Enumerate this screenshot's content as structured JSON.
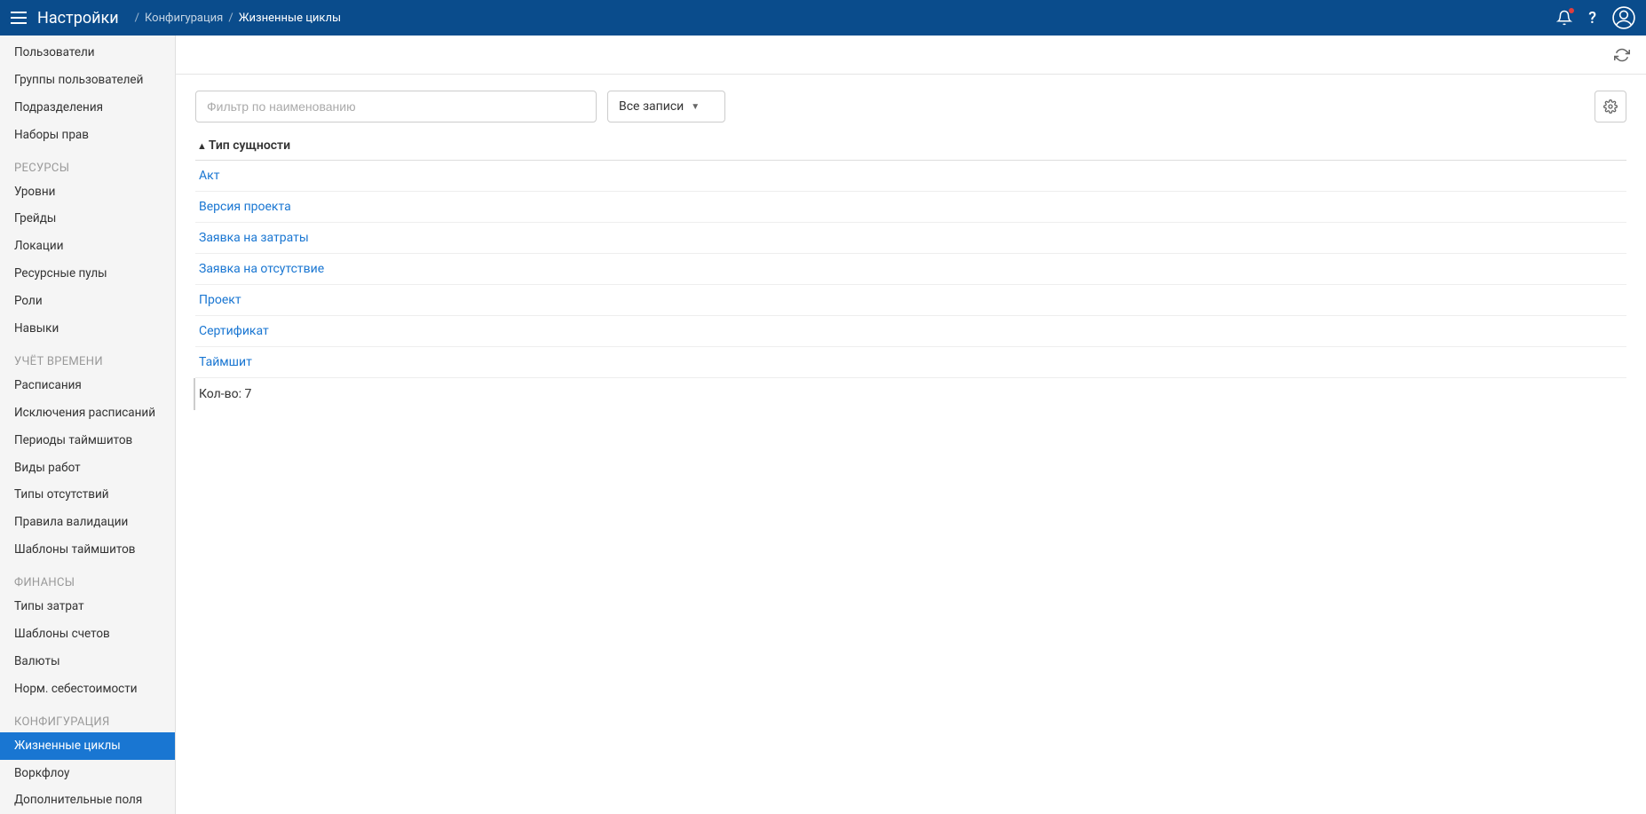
{
  "header": {
    "title": "Настройки",
    "breadcrumb": [
      "Конфигурация",
      "Жизненные циклы"
    ]
  },
  "sidebar": {
    "top_items": [
      "Пользователи",
      "Группы пользователей",
      "Подразделения",
      "Наборы прав"
    ],
    "groups": [
      {
        "title": "РЕСУРСЫ",
        "items": [
          "Уровни",
          "Грейды",
          "Локации",
          "Ресурсные пулы",
          "Роли",
          "Навыки"
        ]
      },
      {
        "title": "УЧЁТ ВРЕМЕНИ",
        "items": [
          "Расписания",
          "Исключения расписаний",
          "Периоды таймшитов",
          "Виды работ",
          "Типы отсутствий",
          "Правила валидации",
          "Шаблоны таймшитов"
        ]
      },
      {
        "title": "ФИНАНСЫ",
        "items": [
          "Типы затрат",
          "Шаблоны счетов",
          "Валюты",
          "Норм. себестоимости"
        ]
      },
      {
        "title": "КОНФИГУРАЦИЯ",
        "items": [
          "Жизненные циклы",
          "Воркфлоу",
          "Дополнительные поля"
        ]
      }
    ],
    "active": "Жизненные циклы"
  },
  "toolbar": {
    "filter_placeholder": "Фильтр по наименованию",
    "select_label": "Все записи"
  },
  "table": {
    "column": "Тип сущности",
    "rows": [
      "Акт",
      "Версия проекта",
      "Заявка на затраты",
      "Заявка на отсутствие",
      "Проект",
      "Сертификат",
      "Таймшит"
    ],
    "footer_label": "Кол-во:",
    "count": 7
  }
}
